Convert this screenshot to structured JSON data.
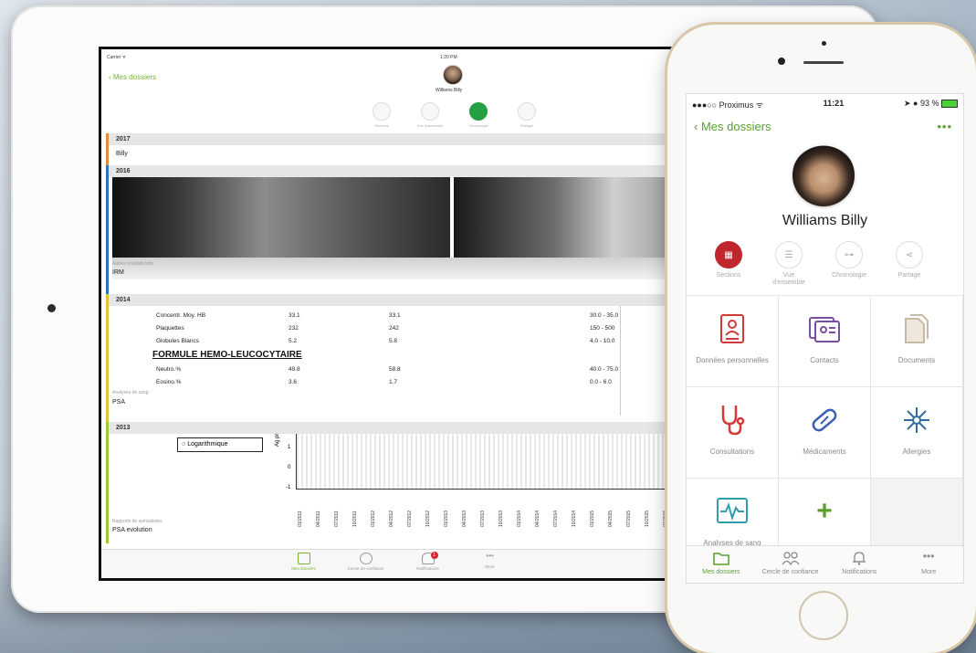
{
  "ipad": {
    "status": {
      "carrier": "Carrier ᯤ",
      "time": "1:20 PM"
    },
    "back_label": "Mes dossiers",
    "patient_name": "Williams Billy",
    "tools": [
      {
        "label": "Sections"
      },
      {
        "label": "Vue d'ensemble"
      },
      {
        "label": "Chronologie"
      },
      {
        "label": "Partage"
      }
    ],
    "timeline": {
      "y2017": {
        "year": "2017",
        "entry": "Billy"
      },
      "y2016": {
        "year": "2016",
        "caption": "Autres résultats labo",
        "entry": "IRM"
      },
      "y2014": {
        "year": "2014",
        "lab_rows": [
          {
            "name": "Concentr. Moy. HB",
            "v1": "33.1",
            "v2": "33.1",
            "range": "30.0 - 35.0"
          },
          {
            "name": "Plaquettes",
            "v1": "232",
            "v2": "242",
            "range": "150 - 500"
          },
          {
            "name": "Globules Blancs",
            "v1": "5.2",
            "v2": "5.8",
            "range": "4.0 - 10.0"
          }
        ],
        "heading": "FORMULE HEMO-LEUCOCYTAIRE",
        "lab_rows2": [
          {
            "name": "Neutro.%",
            "v1": "49.8",
            "v2": "58.8",
            "range": "40.0 - 75.0"
          },
          {
            "name": "Eosino.%",
            "v1": "3.6",
            "v2": "1.7",
            "range": "0.0 - 6.0"
          }
        ],
        "caption": "Analyses de sang",
        "entry": "PSA"
      },
      "y2013": {
        "year": "2013",
        "toggle": "Logarithmique",
        "axis_label": "Ag pr",
        "y_ticks": [
          "1",
          "0",
          "-1"
        ],
        "x_ticks": [
          "01/2011",
          "04/2011",
          "07/2011",
          "10/2011",
          "01/2012",
          "04/2012",
          "07/2012",
          "10/2012",
          "01/2013",
          "04/2013",
          "07/2013",
          "10/2013",
          "01/2014",
          "04/2014",
          "07/2014",
          "10/2014",
          "01/2015",
          "04/2015",
          "07/2015",
          "10/2015",
          "01/2016",
          "04/2016"
        ],
        "caption": "Rapports de spécialistes",
        "entry": "PSA evolution"
      }
    },
    "tabbar": [
      {
        "label": "Mes dossiers"
      },
      {
        "label": "Cercle de confiance"
      },
      {
        "label": "Notifications",
        "badge": "1"
      },
      {
        "label": "More"
      }
    ]
  },
  "iphone": {
    "status": {
      "carrier": "●●●○○ Proximus ᯤ",
      "time": "11:21",
      "battery": "93 %"
    },
    "back_label": "Mes dossiers",
    "more_label": "•••",
    "patient_name": "Williams Billy",
    "tools": [
      {
        "label": "Sections"
      },
      {
        "label": "Vue d'ensemble"
      },
      {
        "label": "Chronologie"
      },
      {
        "label": "Partage"
      }
    ],
    "tiles": [
      {
        "label": "Données personnelles",
        "icon": "id-card-icon",
        "color": "#d23a3a"
      },
      {
        "label": "Contacts",
        "icon": "contacts-icon",
        "color": "#7a4fa0"
      },
      {
        "label": "Documents",
        "icon": "documents-icon",
        "color": "#c8b9a4"
      },
      {
        "label": "Consultations",
        "icon": "stethoscope-icon",
        "color": "#d23a3a"
      },
      {
        "label": "Médicaments",
        "icon": "pill-icon",
        "color": "#3a5fb0"
      },
      {
        "label": "Allergies",
        "icon": "allergy-icon",
        "color": "#2f6fa5"
      },
      {
        "label": "Analyses de sang",
        "icon": "monitor-icon",
        "color": "#2f9db0"
      },
      {
        "label": "",
        "icon": "plus-icon",
        "color": "#5aa02c"
      }
    ],
    "tabbar": [
      {
        "label": "Mes dossiers"
      },
      {
        "label": "Cercle de confiance"
      },
      {
        "label": "Notifications"
      },
      {
        "label": "More"
      }
    ]
  }
}
